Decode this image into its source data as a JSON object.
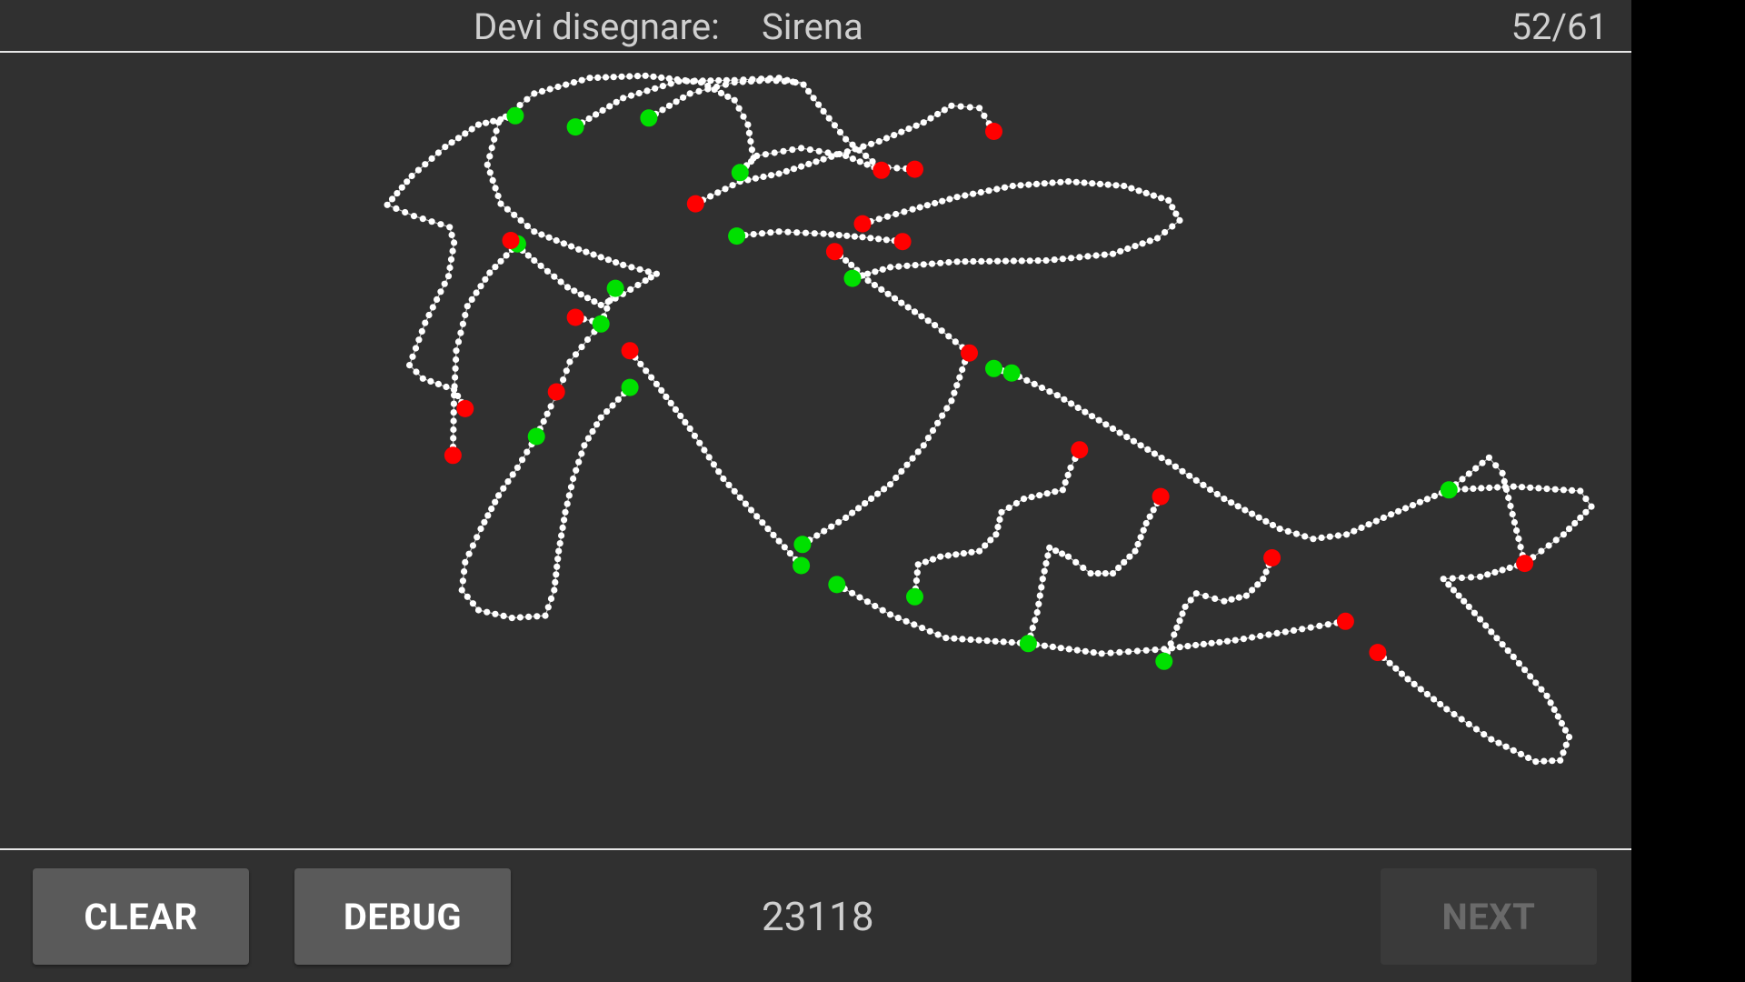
{
  "header": {
    "prompt_label": "Devi disegnare:",
    "prompt_word": "Sirena",
    "progress": "52/61"
  },
  "footer": {
    "clear_label": "CLEAR",
    "debug_label": "DEBUG",
    "score": "23118",
    "next_label": "NEXT"
  },
  "colors": {
    "background": "#303030",
    "stroke_point": "#ffffff",
    "stroke_start": "#00e000",
    "stroke_end": "#ff0000"
  }
}
